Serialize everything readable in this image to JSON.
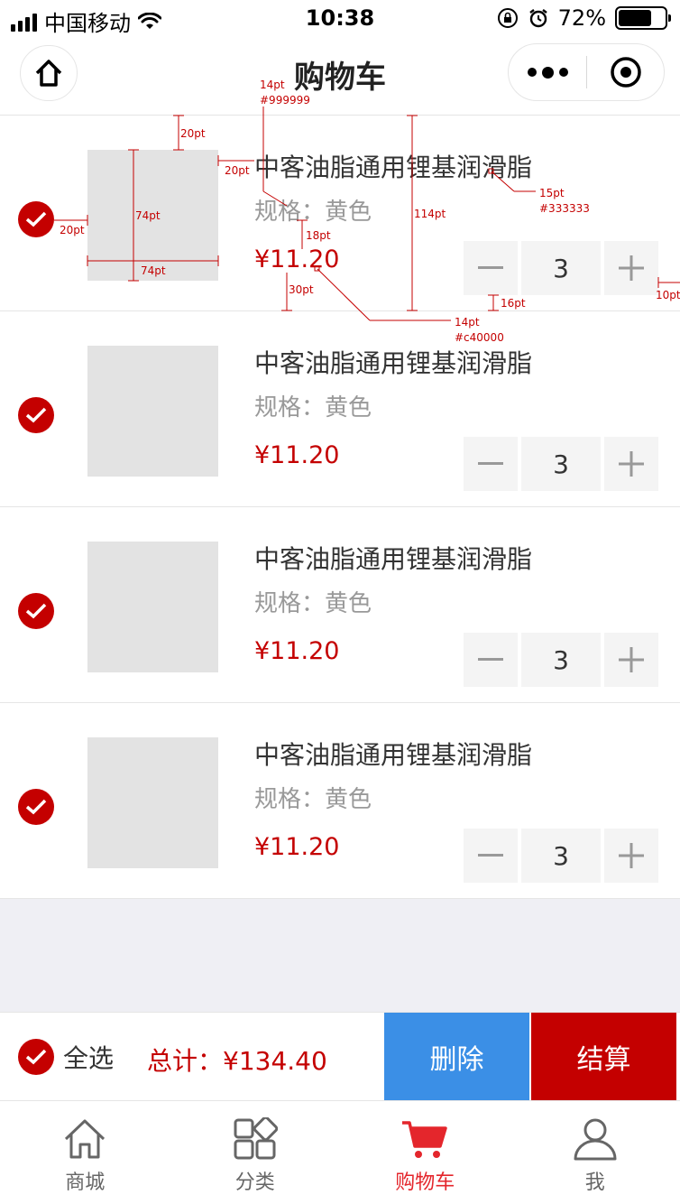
{
  "status_bar": {
    "carrier": "中国移动",
    "time": "10:38",
    "battery": "72%",
    "battery_level": 0.72
  },
  "nav": {
    "title": "购物车"
  },
  "annotations": {
    "line1_size": "14pt",
    "line1_color": "#999999",
    "top_gap": "20pt",
    "image_gap": "20pt",
    "name_size": "15pt",
    "name_color": "#333333",
    "image_height": "74pt",
    "check_gap": "20pt",
    "image_width": "74pt",
    "spec_gap": "18pt",
    "bottom_gap": "30pt",
    "item_height": "114pt",
    "stepper_gap": "16pt",
    "price_size": "14pt",
    "price_color": "#c40000",
    "right_gap": "10pt"
  },
  "items": [
    {
      "name": "中客油脂通用锂基润滑脂",
      "spec": "规格：黄色",
      "price": "¥11.20",
      "qty": "3",
      "minus": "−",
      "plus": "+"
    },
    {
      "name": "中客油脂通用锂基润滑脂",
      "spec": "规格：黄色",
      "price": "¥11.20",
      "qty": "3",
      "minus": "−",
      "plus": "+"
    },
    {
      "name": "中客油脂通用锂基润滑脂",
      "spec": "规格：黄色",
      "price": "¥11.20",
      "qty": "3",
      "minus": "−",
      "plus": "+"
    },
    {
      "name": "中客油脂通用锂基润滑脂",
      "spec": "规格：黄色",
      "price": "¥11.20",
      "qty": "3",
      "minus": "−",
      "plus": "+"
    }
  ],
  "action_bar": {
    "select_all": "全选",
    "total": "总计：¥134.40",
    "delete": "删除",
    "checkout": "结算"
  },
  "tabs": [
    {
      "label": "商城",
      "icon": "home-icon"
    },
    {
      "label": "分类",
      "icon": "category-icon"
    },
    {
      "label": "购物车",
      "icon": "cart-icon"
    },
    {
      "label": "我",
      "icon": "user-icon"
    }
  ],
  "colors": {
    "accent": "#c40000",
    "delete_button": "#3b8fe6",
    "active_tab": "#e4262c",
    "spec_text": "#999999",
    "name_text": "#333333"
  }
}
